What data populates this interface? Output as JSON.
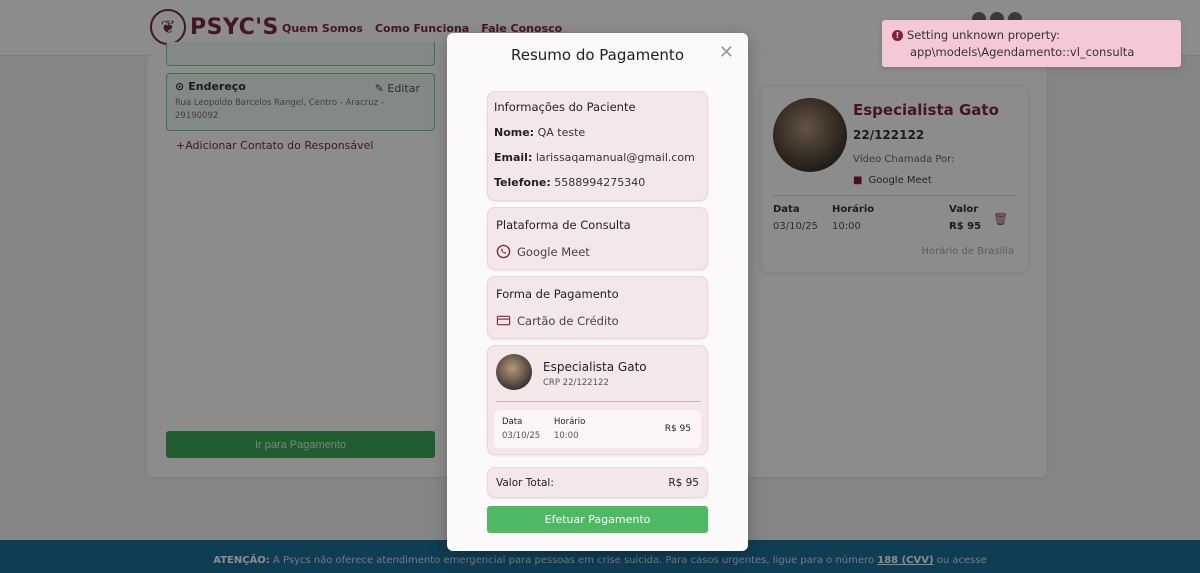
{
  "header": {
    "logo_text": "PSYC'S",
    "nav": [
      "Quem Somos",
      "Como Funciona",
      "Fale Conosco"
    ]
  },
  "background": {
    "address": {
      "title": "Endereço",
      "edit_label": "Editar",
      "text": "Rua Leopoldo Barcelos Rangel, Centro - Aracruz - 29190092"
    },
    "add_contact_label": "Adicionar Contato do Responsável",
    "go_to_payment_label": "Ir para Pagamento",
    "specialist_card": {
      "name": "Especialista Gato",
      "crp": "22/122122",
      "video_call_label": "Vídeo Chamada Por:",
      "platform": "Google Meet",
      "date_header": "Data",
      "date": "03/10/25",
      "time_header": "Horário",
      "time": "10:00",
      "value_header": "Valor",
      "value": "R$ 95",
      "timezone": "Horário de Brasília"
    },
    "footer": {
      "attention_label": "ATENÇÃO:",
      "text": "A Psycs não oferece atendimento emergencial para pessoas em crise suicida. Para casos urgentes, ligue para o número",
      "phone": "188 (CVV)",
      "text_end": "ou acesse"
    }
  },
  "modal": {
    "title": "Resumo do Pagamento",
    "patient": {
      "section_title": "Informações do Paciente",
      "name_label": "Nome:",
      "name": "QA teste",
      "email_label": "Email:",
      "email": "larissaqamanual@gmail.com",
      "phone_label": "Telefone:",
      "phone": "5588994275340"
    },
    "platform": {
      "section_title": "Plataforma de Consulta",
      "value": "Google Meet"
    },
    "payment_method": {
      "section_title": "Forma de Pagamento",
      "value": "Cartão de Crédito"
    },
    "specialist": {
      "name": "Especialista Gato",
      "crp": "CRP 22/122122",
      "date_header": "Data",
      "date": "03/10/25",
      "time_header": "Horário",
      "time": "10:00",
      "price": "R$ 95"
    },
    "total": {
      "label": "Valor Total:",
      "value": "R$ 95"
    },
    "submit_label": "Efetuar Pagamento"
  },
  "toast": {
    "line1": "Setting unknown property:",
    "line2": "app\\models\\Agendamento::vl_consulta"
  },
  "colors": {
    "brand": "#7a2b3e",
    "success": "#4dba63",
    "toast_bg": "#f5c8d6"
  }
}
